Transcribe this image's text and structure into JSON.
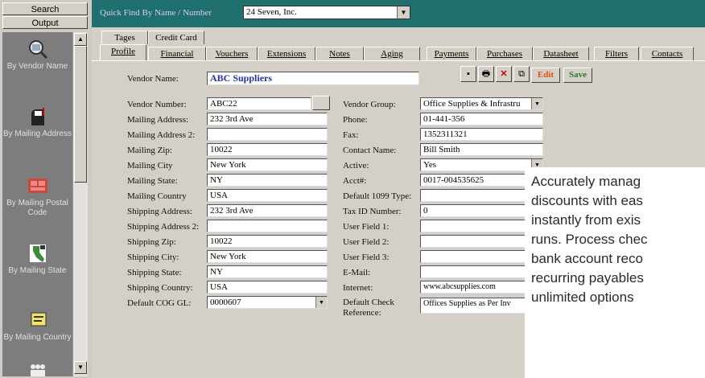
{
  "sidebar": {
    "search_label": "Search",
    "output_label": "Output",
    "items": [
      {
        "label": "By Vendor Name",
        "icon": "magnifier-icon"
      },
      {
        "label": "By Mailing Address",
        "icon": "mailbox-icon"
      },
      {
        "label": "By Mailing Postal Code",
        "icon": "postal-code-icon"
      },
      {
        "label": "By Mailing State",
        "icon": "state-map-icon"
      },
      {
        "label": "By Mailing Country",
        "icon": "country-card-icon"
      }
    ]
  },
  "quick_find": {
    "label": "Quick Find By Name / Number",
    "value": "24 Seven, Inc."
  },
  "tabs_top": [
    "Tages",
    "Credit Card"
  ],
  "tabs": [
    "Profile",
    "Financial",
    "Vouchers",
    "Extensions",
    "Notes",
    "Aging",
    "Payments",
    "Purchases",
    "Datasheet",
    "Filters",
    "Contacts"
  ],
  "toolbar": {
    "edit_label": "Edit",
    "save_label": "Save"
  },
  "form": {
    "vendor_name_label": "Vendor Name:",
    "vendor_name": "ABC Suppliers",
    "left": [
      {
        "label": "Vendor Number:",
        "value": "ABC22"
      },
      {
        "label": "Mailing Address:",
        "value": "232 3rd Ave"
      },
      {
        "label": "Mailing Address 2:",
        "value": ""
      },
      {
        "label": "Mailing Zip:",
        "value": "10022"
      },
      {
        "label": "Mailing City",
        "value": "New York"
      },
      {
        "label": "Mailing State:",
        "value": "NY"
      },
      {
        "label": "Mailing Country",
        "value": "USA"
      },
      {
        "label": "Shipping Address:",
        "value": "232 3rd Ave"
      },
      {
        "label": "Shipping Address 2:",
        "value": ""
      },
      {
        "label": "Shipping Zip:",
        "value": "10022"
      },
      {
        "label": "Shipping City:",
        "value": "New York"
      },
      {
        "label": "Shipping State:",
        "value": "NY"
      },
      {
        "label": "Shipping Country:",
        "value": "USA"
      },
      {
        "label": "Default COG GL:",
        "value": "0000607"
      }
    ],
    "right": [
      {
        "label": "Vendor Group:",
        "value": "Office Supplies & Infrastru"
      },
      {
        "label": "Phone:",
        "value": "01-441-356"
      },
      {
        "label": "Fax:",
        "value": "1352311321"
      },
      {
        "label": "Contact Name:",
        "value": "Bill Smith"
      },
      {
        "label": "Active:",
        "value": "Yes"
      },
      {
        "label": "Acct#:",
        "value": "0017-004535625"
      },
      {
        "label": "Default 1099 Type:",
        "value": ""
      },
      {
        "label": "Tax ID Number:",
        "value": "0"
      },
      {
        "label": "User Field 1:",
        "value": ""
      },
      {
        "label": "User Field 2:",
        "value": ""
      },
      {
        "label": "User Field 3:",
        "value": ""
      },
      {
        "label": "E-Mail:",
        "value": ""
      },
      {
        "label": "Internet:",
        "value": "www.abcsupplies.com"
      },
      {
        "label": "Default Check\nReference:",
        "value": "Offices Supplies as Per Inv"
      }
    ]
  },
  "overlay_text": "Accurately manag\ndiscounts with eas\ninstantly from exis\nruns. Process chec\nbank account reco\nrecurring payables\nunlimited options"
}
